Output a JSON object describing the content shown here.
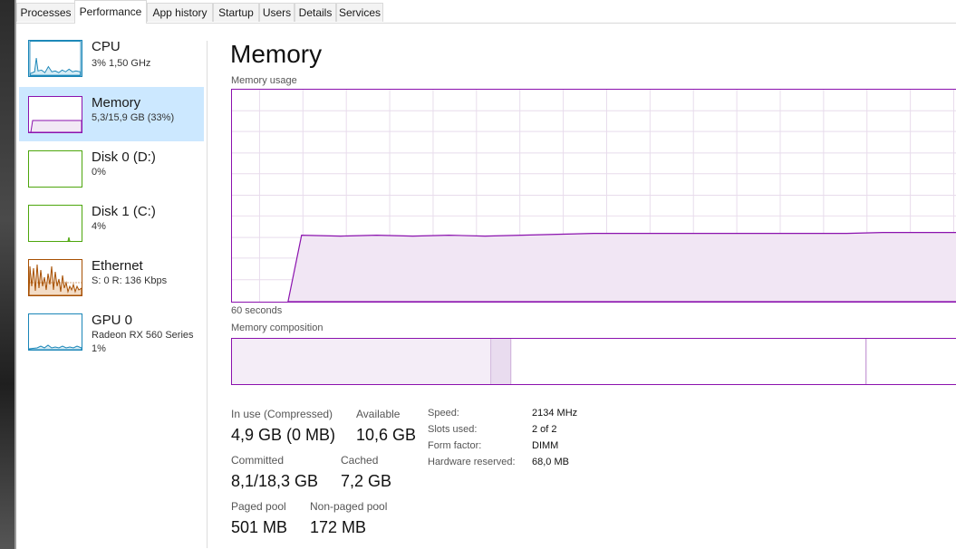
{
  "tabs": [
    "Processes",
    "Performance",
    "App history",
    "Startup",
    "Users",
    "Details",
    "Services"
  ],
  "active_tab": "Performance",
  "sidebar": {
    "items": [
      {
        "title": "CPU",
        "sub": "3% 1,50 GHz",
        "sub2": "",
        "color": "#1a86b8"
      },
      {
        "title": "Memory",
        "sub": "5,3/15,9 GB (33%)",
        "sub2": "",
        "color": "#8b12ae"
      },
      {
        "title": "Disk 0 (D:)",
        "sub": "0%",
        "sub2": "",
        "color": "#4da60c"
      },
      {
        "title": "Disk 1 (C:)",
        "sub": "4%",
        "sub2": "",
        "color": "#4da60c"
      },
      {
        "title": "Ethernet",
        "sub": "S: 0 R: 136 Kbps",
        "sub2": "",
        "color": "#a74f01"
      },
      {
        "title": "GPU 0",
        "sub": "Radeon RX 560 Series",
        "sub2": "1%",
        "color": "#1a86b8"
      }
    ]
  },
  "main": {
    "title": "Memory",
    "usage_label": "Memory usage",
    "time_label": "60 seconds",
    "composition_label": "Memory composition",
    "accent_color": "#8b12ae",
    "usage_level_fraction": 0.33
  },
  "stats": {
    "in_use_label": "In use (Compressed)",
    "in_use_value": "4,9 GB (0 MB)",
    "available_label": "Available",
    "available_value": "10,6 GB",
    "committed_label": "Committed",
    "committed_value": "8,1/18,3 GB",
    "cached_label": "Cached",
    "cached_value": "7,2 GB",
    "paged_label": "Paged pool",
    "paged_value": "501 MB",
    "nonpaged_label": "Non-paged pool",
    "nonpaged_value": "172 MB"
  },
  "specs": [
    {
      "key": "Speed:",
      "value": "2134 MHz"
    },
    {
      "key": "Slots used:",
      "value": "2 of 2"
    },
    {
      "key": "Form factor:",
      "value": "DIMM"
    },
    {
      "key": "Hardware reserved:",
      "value": "68,0 MB"
    }
  ]
}
